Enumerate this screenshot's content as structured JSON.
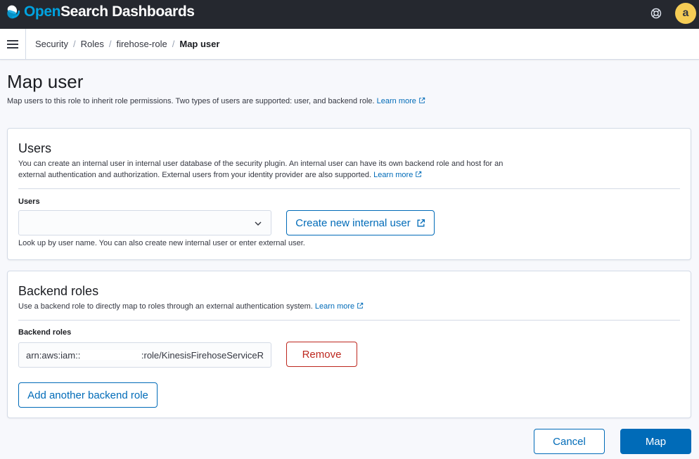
{
  "app": {
    "brand_open": "Open",
    "brand_rest": "Search Dashboards",
    "avatar_letter": "a",
    "colors": {
      "topbar": "#25282f",
      "accent": "#006bb8",
      "danger": "#bd271e",
      "avatar": "#f5cc55",
      "brand": "#00a3e0"
    }
  },
  "breadcrumbs": [
    {
      "label": "Security"
    },
    {
      "label": "Roles"
    },
    {
      "label": "firehose-role"
    },
    {
      "label": "Map user"
    }
  ],
  "header": {
    "title": "Map user",
    "description": "Map users to this role to inherit role permissions. Two types of users are supported: user, and backend role.",
    "learn_more": "Learn more"
  },
  "users_panel": {
    "title": "Users",
    "description": "You can create an internal user in internal user database of the security plugin. An internal user can have its own backend role and host for an external authentication and authorization. External users from your identity provider are also supported.",
    "learn_more": "Learn more",
    "field_label": "Users",
    "combo_value": "",
    "create_button": "Create new internal user",
    "help": "Look up by user name. You can also create new internal user or enter external user."
  },
  "backend_panel": {
    "title": "Backend roles",
    "description": "Use a backend role to directly map to roles through an external authentication system.",
    "learn_more": "Learn more",
    "field_label": "Backend roles",
    "value_prefix": "arn:aws:iam::",
    "value_suffix": ":role/KinesisFirehoseServiceR",
    "remove_button": "Remove",
    "add_button": "Add another backend role"
  },
  "footer": {
    "cancel": "Cancel",
    "map": "Map"
  }
}
